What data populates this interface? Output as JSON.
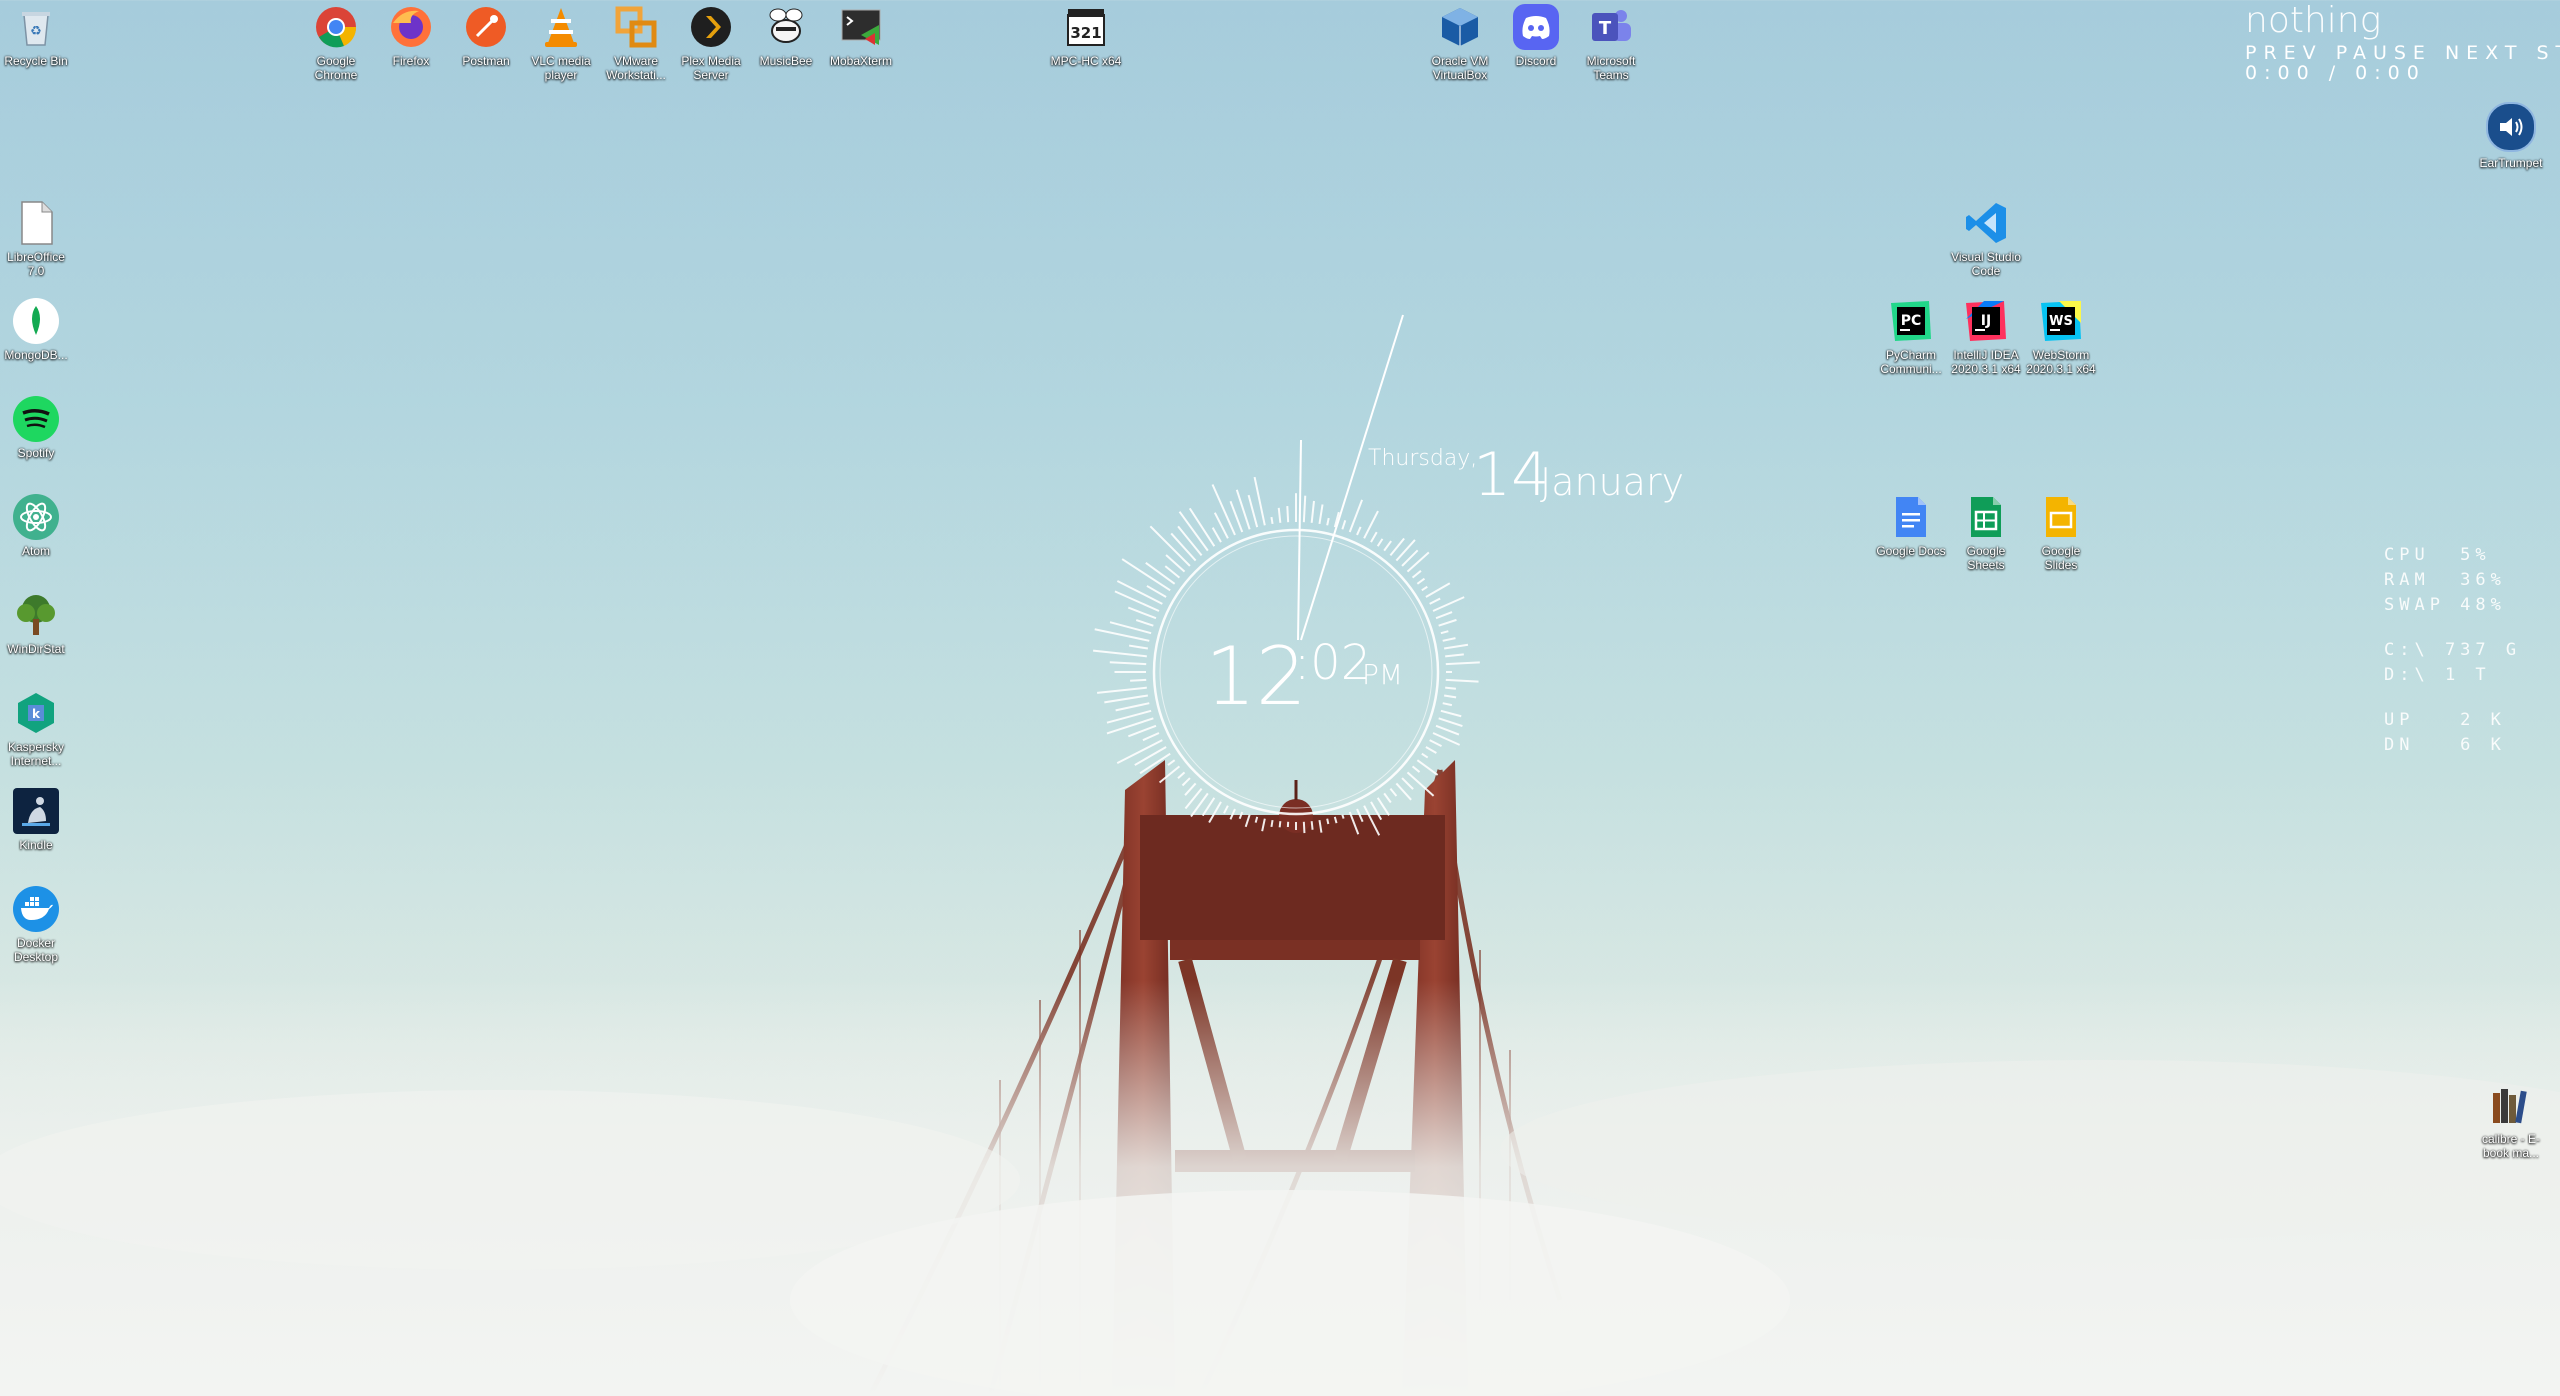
{
  "desktop": {
    "top_icons": [
      {
        "label": "Recycle Bin",
        "icon": "recycle-bin-icon"
      },
      {
        "label": "Google Chrome",
        "icon": "chrome-icon"
      },
      {
        "label": "Firefox",
        "icon": "firefox-icon"
      },
      {
        "label": "Postman",
        "icon": "postman-icon"
      },
      {
        "label": "VLC media player",
        "icon": "vlc-icon"
      },
      {
        "label": "VMware Workstati...",
        "icon": "vmware-icon"
      },
      {
        "label": "Plex Media Server",
        "icon": "plex-icon"
      },
      {
        "label": "MusicBee",
        "icon": "musicbee-icon"
      },
      {
        "label": "MobaXterm",
        "icon": "mobaxterm-icon"
      },
      {
        "label": "MPC-HC x64",
        "icon": "mpc-hc-icon"
      },
      {
        "label": "Oracle VM VirtualBox",
        "icon": "virtualbox-icon"
      },
      {
        "label": "Discord",
        "icon": "discord-icon"
      },
      {
        "label": "Microsoft Teams",
        "icon": "teams-icon"
      }
    ],
    "left_icons": [
      {
        "label": "LibreOffice 7.0",
        "icon": "libreoffice-icon"
      },
      {
        "label": "MongoDB...",
        "icon": "mongodb-icon"
      },
      {
        "label": "Spotify",
        "icon": "spotify-icon"
      },
      {
        "label": "Atom",
        "icon": "atom-icon"
      },
      {
        "label": "WinDirStat",
        "icon": "windirstat-icon"
      },
      {
        "label": "Kaspersky Internet...",
        "icon": "kaspersky-icon"
      },
      {
        "label": "Kindle",
        "icon": "kindle-icon"
      },
      {
        "label": "Docker Desktop",
        "icon": "docker-icon"
      }
    ],
    "right_icons": [
      {
        "label": "Visual Studio Code",
        "icon": "vscode-icon"
      },
      {
        "label": "PyCharm Communi...",
        "icon": "pycharm-icon"
      },
      {
        "label": "IntelliJ IDEA 2020.3.1 x64",
        "icon": "intellij-icon"
      },
      {
        "label": "WebStorm 2020.3.1 x64",
        "icon": "webstorm-icon"
      },
      {
        "label": "Google Docs",
        "icon": "google-docs-icon"
      },
      {
        "label": "Google Sheets",
        "icon": "google-sheets-icon"
      },
      {
        "label": "Google Slides",
        "icon": "google-slides-icon"
      },
      {
        "label": "EarTrumpet",
        "icon": "speaker-icon"
      },
      {
        "label": "calibre - E-book ma...",
        "icon": "calibre-icon"
      }
    ]
  },
  "media_widget": {
    "title": "nothing",
    "controls": "PREV  PAUSE  NEXT  STOP",
    "time": "0:00 / 0:00"
  },
  "clock_widget": {
    "weekday": "Thursday,",
    "day": "14",
    "month": "January",
    "hour": "12",
    "minute": ":02",
    "ampm": "PM"
  },
  "system_stats": {
    "cpu": "CPU  5%",
    "ram": "RAM  36%",
    "swap": "SWAP 48%",
    "disk_c": "C:\\ 737 G",
    "disk_d": "D:\\ 1 T",
    "net_up": "UP   2 K",
    "net_dn": "DN   6 K"
  },
  "colors": {
    "sky_top": "#a6ccdc",
    "fog": "#eef1ef",
    "bridge": "#8a3a2c"
  }
}
